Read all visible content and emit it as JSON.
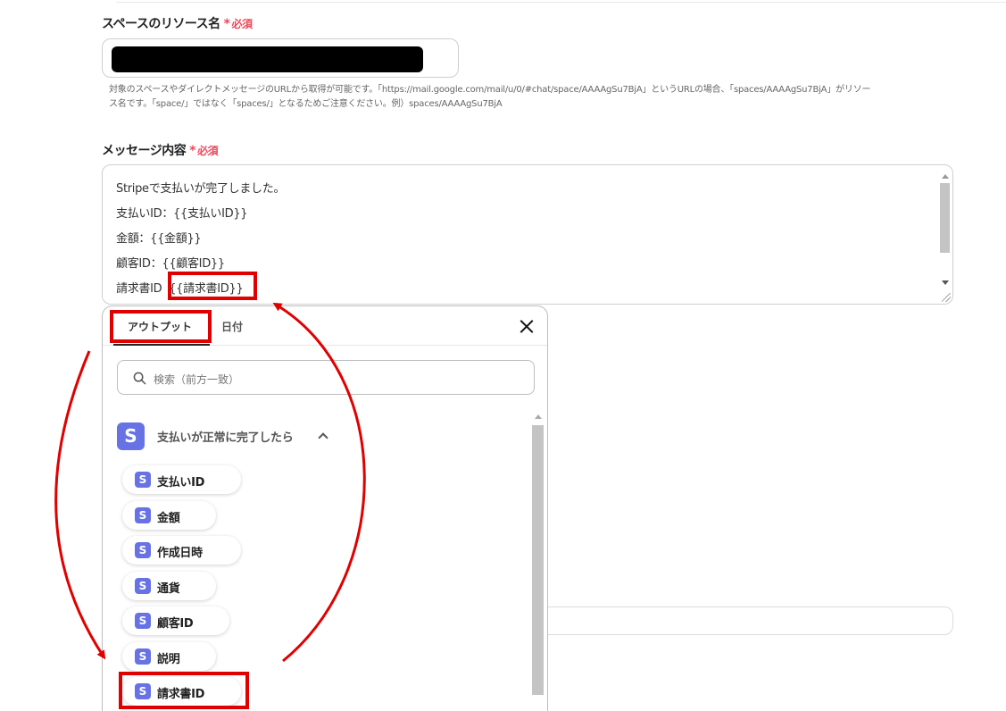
{
  "space_field": {
    "label": "スペースのリソース名",
    "required_star": "*",
    "required_label": "必須",
    "helper_line1": "対象のスペースやダイレクトメッセージのURLから取得が可能です。「https://mail.google.com/mail/u/0/#chat/space/AAAAgSu7BjA」というURLの場合、「spaces/AAAAgSu7BjA」がリソー",
    "helper_line2": "ス名です。「space/」ではなく「spaces/」となるためご注意ください。例）spaces/AAAAgSu7BjA"
  },
  "message_field": {
    "label": "メッセージ内容",
    "required_star": "*",
    "required_label": "必須",
    "lines": [
      "Stripeで支払いが完了しました。",
      "支払いID：{{支払いID}}",
      "金額：{{金額}}",
      "顧客ID：{{顧客ID}}"
    ],
    "last_line_prefix": "請求書ID",
    "last_line_token": "{{請求書ID}}"
  },
  "popup": {
    "tabs": [
      "アウトプット",
      "日付"
    ],
    "active_tab": "アウトプット",
    "search_placeholder": "検索（前方一致）",
    "group_icon": "S",
    "group_title": "支払いが正常に完了したら",
    "items": [
      {
        "icon": "S",
        "label": "支払いID"
      },
      {
        "icon": "S",
        "label": "金額"
      },
      {
        "icon": "S",
        "label": "作成日時"
      },
      {
        "icon": "S",
        "label": "通貨"
      },
      {
        "icon": "S",
        "label": "顧客ID"
      },
      {
        "icon": "S",
        "label": "説明"
      },
      {
        "icon": "S",
        "label": "請求書ID"
      }
    ]
  },
  "colors": {
    "required": "#e8495a",
    "stripe": "#6772e5",
    "highlight": "#e00000"
  }
}
